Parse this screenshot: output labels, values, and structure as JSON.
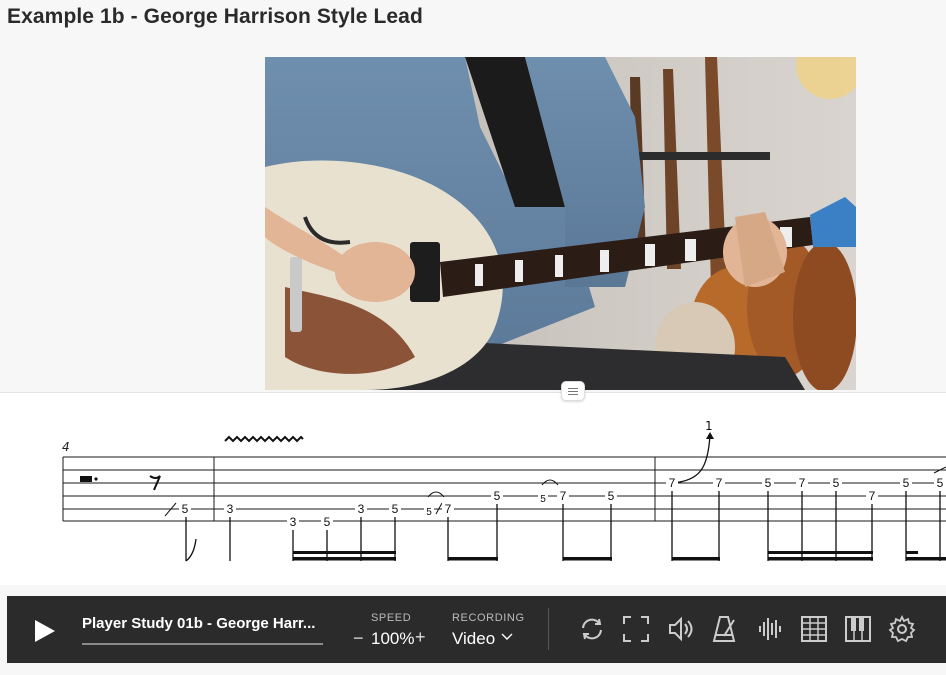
{
  "page": {
    "title": "Example 1b - George Harrison Style Lead"
  },
  "notation": {
    "measure_number": "4",
    "bend_label": "1",
    "fret_numbers": [
      "5",
      "3",
      "3",
      "5",
      "3",
      "5",
      "5",
      "7",
      "5",
      "5",
      "7",
      "5",
      "7",
      "7",
      "5",
      "7",
      "5",
      "7",
      "5",
      "5"
    ]
  },
  "player": {
    "track_title": "Player Study 01b - George Harr...",
    "speed_label": "SPEED",
    "speed_minus": "−",
    "speed_value": "100%",
    "speed_plus": "+",
    "recording_label": "RECORDING",
    "recording_value": "Video",
    "icons": [
      "play-icon",
      "loop-icon",
      "fullscreen-icon",
      "volume-icon",
      "metronome-icon",
      "waveform-icon",
      "tab-grid-icon",
      "piano-icon",
      "settings-icon"
    ]
  },
  "colors": {
    "player_bg": "#2b2b2b",
    "page_bg": "#f7f7f8",
    "staff_ink": "#1a1a1a"
  }
}
